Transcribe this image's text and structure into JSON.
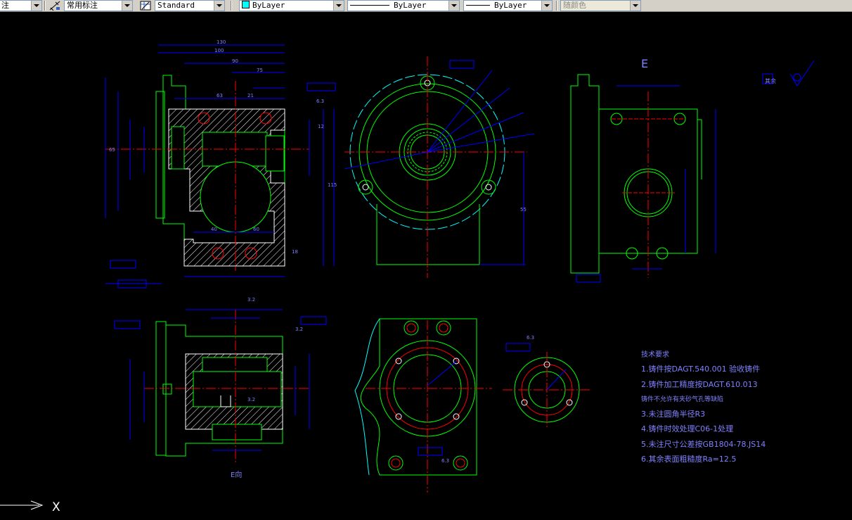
{
  "toolbar": {
    "text_style_partial": "注",
    "dim_style": "常用标注",
    "table_style": "Standard",
    "layer": "ByLayer",
    "linetype": "ByLayer",
    "lineweight": "ByLayer",
    "color": "随颜色"
  },
  "ucs": {
    "axis_label": "X"
  },
  "notes": {
    "heading": "技术要求",
    "lines": [
      "1.铸件按DAGT.540.001 验收铸件",
      "2.铸件加工精度按DAGT.610.013",
      "  铸件不允许有夹砂气孔等缺陷",
      "3.未注圆角半径R3",
      "4.铸件时效处理C06-1处理",
      "5.未注尺寸公差按GB1804-78.JS14",
      "6.其余表面粗糙度Ra=12.5"
    ]
  },
  "drawing": {
    "dim_labels": [
      "130",
      "100",
      "90",
      "75",
      "21",
      "63",
      "65",
      "115",
      "60",
      "40",
      "55",
      "18",
      "12",
      "6.3",
      "3.2",
      "6.3",
      "3.2",
      "6.3",
      "3.2"
    ],
    "view_label": "E",
    "section_label": "E向",
    "roughness_other": "其余",
    "colors": {
      "outline": "#00ff00",
      "dimension": "#0000ff",
      "center": "#ff0000",
      "hatch": "#ffffff",
      "text_note": "#8080ff",
      "hidden": "#00ffff"
    }
  }
}
